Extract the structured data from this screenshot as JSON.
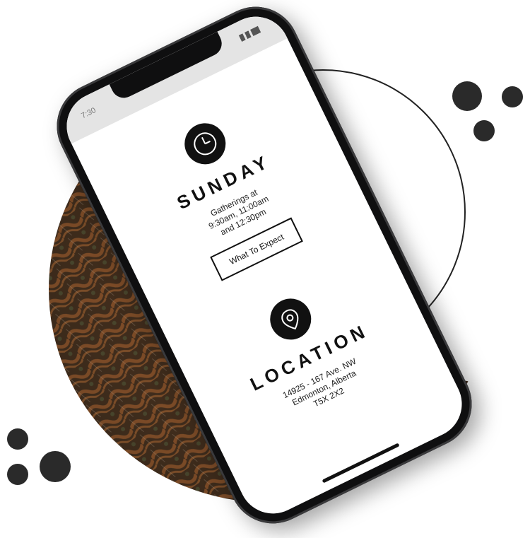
{
  "phone": {
    "status_time": "7:30",
    "status_title": "",
    "sunday": {
      "heading": "SUNDAY",
      "lines": [
        "Gatherings at",
        "9:30am, 11:00am",
        "and 12:30pm"
      ],
      "button_label": "What To Expect",
      "icon": "clock-icon"
    },
    "location": {
      "heading": "LOCATION",
      "lines": [
        "14925 - 167 Ave. NW",
        "Edmonton, Alberta",
        "T5X 2X2"
      ],
      "icon": "location-pin-icon"
    }
  },
  "colors": {
    "dots": "#2a2a2a",
    "phone_frame": "#0f0f10",
    "screen_bg": "#ffffff",
    "status_bar_bg": "#e4e4e4",
    "forest_dark": "#2b2117",
    "forest_rust": "#8a5229"
  }
}
